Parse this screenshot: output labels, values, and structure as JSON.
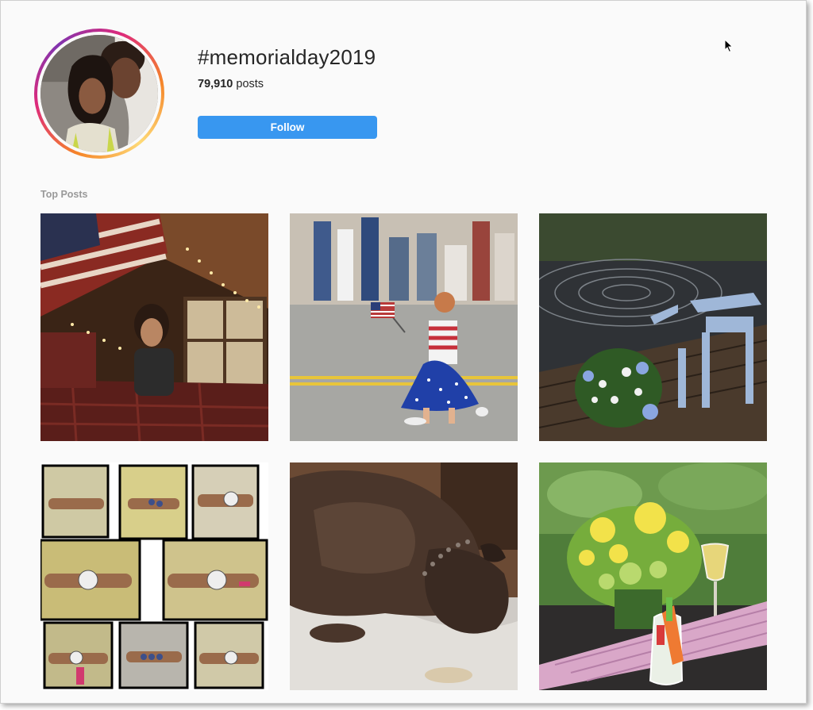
{
  "hashtag": {
    "title": "#memorialday2019",
    "posts_count": "79,910",
    "posts_label": "posts",
    "follow_label": "Follow"
  },
  "sections": {
    "top_posts_label": "Top Posts"
  },
  "posts": [
    {
      "name": "post-cabin-flag-bedroom"
    },
    {
      "name": "post-girl-with-flag-parade"
    },
    {
      "name": "post-dock-chair-lake"
    },
    {
      "name": "post-bracelet-collage"
    },
    {
      "name": "post-sleeping-dog"
    },
    {
      "name": "post-flowers-table"
    }
  ],
  "colors": {
    "follow_button": "#3897f0",
    "background": "#fafafa",
    "muted_text": "#999999"
  }
}
